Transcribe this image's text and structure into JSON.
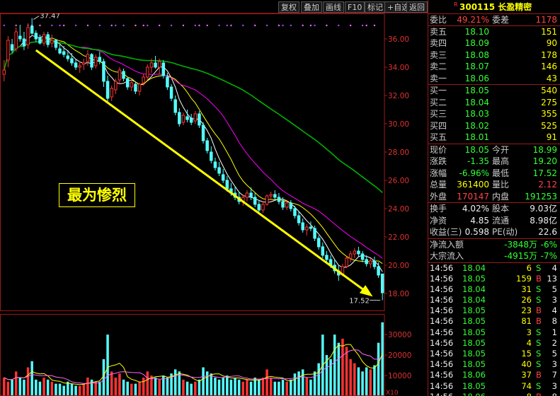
{
  "toolbar": {
    "buttons": [
      "复权",
      "叠加",
      "画线",
      "F10",
      "标记",
      "+自选",
      "返回"
    ]
  },
  "annotation": "最为惨烈",
  "chart_data": {
    "type": "candlestick",
    "candles": [
      [
        33.5,
        34.5,
        33.0,
        33.8
      ],
      [
        34.5,
        36.2,
        34.0,
        35.9
      ],
      [
        35.6,
        36.0,
        35.0,
        35.2
      ],
      [
        35.3,
        36.8,
        35.1,
        36.5
      ],
      [
        36.2,
        37.0,
        35.8,
        36.0
      ],
      [
        36.0,
        36.5,
        35.2,
        35.5
      ],
      [
        35.6,
        37.1,
        35.3,
        36.8
      ],
      [
        36.9,
        37.47,
        36.3,
        36.4
      ],
      [
        36.4,
        36.6,
        35.8,
        36.0
      ],
      [
        36.1,
        36.3,
        35.6,
        35.7
      ],
      [
        35.7,
        36.5,
        35.5,
        36.3
      ],
      [
        36.3,
        36.5,
        35.4,
        35.6
      ],
      [
        35.7,
        36.3,
        35.4,
        35.9
      ],
      [
        35.9,
        36.0,
        35.2,
        35.4
      ],
      [
        35.3,
        35.6,
        34.9,
        35.0
      ],
      [
        35.1,
        35.5,
        34.7,
        34.9
      ],
      [
        34.8,
        35.2,
        34.4,
        34.6
      ],
      [
        34.6,
        35.0,
        34.1,
        34.3
      ],
      [
        34.3,
        34.6,
        33.8,
        34.0
      ],
      [
        34.0,
        34.4,
        33.6,
        34.1
      ],
      [
        34.2,
        34.6,
        33.8,
        34.3
      ],
      [
        34.4,
        35.2,
        34.1,
        34.9
      ],
      [
        34.9,
        35.0,
        33.8,
        34.0
      ],
      [
        34.1,
        34.9,
        33.9,
        34.7
      ],
      [
        34.7,
        35.1,
        34.2,
        34.4
      ],
      [
        34.4,
        34.6,
        32.6,
        33.0
      ],
      [
        33.0,
        33.4,
        31.5,
        31.8
      ],
      [
        31.9,
        32.7,
        31.6,
        32.5
      ],
      [
        32.4,
        33.2,
        32.1,
        33.0
      ],
      [
        33.1,
        34.0,
        32.8,
        33.8
      ],
      [
        33.7,
        33.9,
        33.0,
        33.2
      ],
      [
        33.2,
        33.3,
        32.4,
        32.6
      ],
      [
        32.6,
        33.1,
        32.3,
        32.9
      ],
      [
        32.8,
        33.0,
        32.1,
        32.3
      ],
      [
        32.3,
        32.9,
        32.0,
        32.8
      ],
      [
        32.9,
        33.5,
        32.7,
        33.3
      ],
      [
        33.3,
        34.2,
        33.1,
        34.0
      ],
      [
        34.0,
        34.6,
        33.6,
        34.3
      ],
      [
        34.3,
        34.8,
        33.9,
        34.0
      ],
      [
        34.0,
        34.6,
        33.5,
        34.4
      ],
      [
        34.3,
        34.5,
        33.2,
        33.4
      ],
      [
        33.3,
        33.6,
        32.4,
        32.6
      ],
      [
        32.6,
        32.8,
        31.6,
        31.8
      ],
      [
        31.7,
        32.0,
        30.6,
        30.8
      ],
      [
        30.8,
        31.1,
        29.8,
        30.0
      ],
      [
        30.1,
        30.8,
        29.9,
        30.6
      ],
      [
        30.5,
        31.0,
        30.1,
        30.3
      ],
      [
        30.4,
        30.7,
        29.9,
        30.1
      ],
      [
        30.2,
        30.9,
        30.0,
        30.7
      ],
      [
        30.7,
        30.9,
        29.7,
        29.9
      ],
      [
        29.9,
        30.1,
        28.6,
        28.8
      ],
      [
        28.8,
        29.0,
        27.9,
        28.1
      ],
      [
        28.0,
        28.4,
        27.2,
        27.4
      ],
      [
        27.3,
        27.6,
        26.7,
        26.9
      ],
      [
        26.9,
        27.3,
        26.3,
        26.5
      ],
      [
        26.4,
        26.8,
        25.8,
        26.0
      ],
      [
        26.0,
        26.3,
        25.2,
        25.4
      ],
      [
        25.4,
        25.8,
        24.9,
        25.1
      ],
      [
        25.1,
        25.6,
        24.6,
        24.8
      ],
      [
        24.8,
        25.2,
        24.3,
        24.5
      ],
      [
        24.5,
        25.0,
        24.2,
        24.8
      ],
      [
        24.8,
        25.3,
        24.5,
        25.1
      ],
      [
        25.1,
        25.5,
        24.6,
        24.8
      ],
      [
        24.8,
        25.1,
        24.1,
        24.3
      ],
      [
        24.3,
        24.6,
        23.7,
        23.9
      ],
      [
        23.9,
        24.5,
        23.7,
        24.3
      ],
      [
        24.3,
        25.0,
        24.2,
        24.9
      ],
      [
        24.9,
        25.2,
        24.6,
        25.0
      ],
      [
        25.0,
        25.3,
        24.6,
        24.8
      ],
      [
        24.8,
        25.1,
        24.3,
        24.5
      ],
      [
        24.5,
        24.8,
        23.9,
        24.1
      ],
      [
        24.1,
        24.6,
        23.9,
        24.4
      ],
      [
        24.4,
        24.6,
        23.8,
        24.0
      ],
      [
        24.0,
        24.2,
        23.3,
        23.5
      ],
      [
        23.5,
        23.8,
        22.8,
        23.0
      ],
      [
        23.0,
        23.3,
        22.3,
        22.5
      ],
      [
        22.5,
        22.9,
        22.1,
        22.7
      ],
      [
        22.7,
        23.1,
        22.4,
        22.6
      ],
      [
        22.6,
        22.8,
        21.7,
        21.9
      ],
      [
        21.9,
        22.1,
        21.1,
        21.3
      ],
      [
        21.3,
        21.6,
        20.5,
        20.7
      ],
      [
        20.7,
        21.0,
        20.2,
        20.4
      ],
      [
        20.4,
        20.7,
        19.8,
        20.0
      ],
      [
        20.0,
        20.4,
        19.4,
        19.6
      ],
      [
        19.6,
        20.0,
        18.9,
        19.3
      ],
      [
        19.3,
        20.1,
        19.2,
        19.9
      ],
      [
        19.9,
        20.6,
        19.8,
        20.5
      ],
      [
        20.5,
        21.0,
        20.2,
        20.8
      ],
      [
        20.8,
        21.2,
        20.5,
        21.0
      ],
      [
        21.0,
        21.3,
        20.6,
        20.8
      ],
      [
        20.8,
        21.0,
        20.2,
        20.4
      ],
      [
        20.4,
        20.7,
        19.9,
        20.1
      ],
      [
        20.1,
        20.5,
        19.8,
        20.3
      ],
      [
        20.3,
        20.6,
        19.7,
        19.9
      ],
      [
        19.9,
        20.2,
        19.1,
        19.3
      ],
      [
        19.38,
        19.4,
        17.52,
        18.05
      ]
    ],
    "volumes": [
      9000,
      7000,
      8000,
      12000,
      9000,
      8000,
      14000,
      17000,
      8000,
      7000,
      9000,
      8000,
      7000,
      6000,
      6000,
      5000,
      7000,
      6000,
      5000,
      5000,
      6000,
      9000,
      8000,
      7000,
      7000,
      18000,
      30000,
      12000,
      9000,
      11000,
      8000,
      7000,
      6000,
      6000,
      7000,
      9000,
      12000,
      10000,
      9000,
      8000,
      10000,
      9000,
      11000,
      13000,
      12000,
      8000,
      7000,
      6000,
      7000,
      8000,
      14000,
      12000,
      11000,
      9000,
      8000,
      9000,
      10000,
      8000,
      9000,
      8000,
      7000,
      8000,
      7000,
      9000,
      8000,
      9000,
      13000,
      9000,
      7000,
      7000,
      8000,
      7000,
      8000,
      11000,
      12000,
      13000,
      9000,
      8000,
      12000,
      16000,
      30000,
      20000,
      18000,
      30000,
      26000,
      28000,
      24000,
      18000,
      16000,
      14000,
      12000,
      14000,
      13000,
      15000,
      26000,
      36000
    ],
    "ma_periods": [
      5,
      10,
      20,
      60
    ],
    "ma_colors": [
      "#ffffff",
      "#ffff00",
      "#ff00ff",
      "#00b000"
    ],
    "ylim": [
      16.8,
      37.8
    ],
    "yticks": [
      "36.00",
      "34.00",
      "32.00",
      "30.00",
      "28.00",
      "26.00",
      "24.00",
      "22.00",
      "20.00",
      "18.00"
    ],
    "vol_ylim": [
      0,
      38000
    ],
    "vol_ticks": [
      "30000",
      "20000",
      "10000"
    ],
    "vol_unit": "X10",
    "max_label": "37.47",
    "min_label": "17.52",
    "colors": {
      "up": "#ff3333",
      "down": "#54ffff",
      "trend_arrow": "#ffff00"
    }
  },
  "quote": {
    "code": "300115",
    "name": "长盈精密",
    "r_mark": "R",
    "webi_label": "委比",
    "webi": "49.21%",
    "weicha_label": "委差",
    "weicha": "1178",
    "asks": [
      {
        "label": "卖五",
        "price": "18.10",
        "vol": "151"
      },
      {
        "label": "卖四",
        "price": "18.09",
        "vol": "90"
      },
      {
        "label": "卖三",
        "price": "18.08",
        "vol": "178"
      },
      {
        "label": "卖二",
        "price": "18.07",
        "vol": "146"
      },
      {
        "label": "卖一",
        "price": "18.06",
        "vol": "43"
      }
    ],
    "bids": [
      {
        "label": "买一",
        "price": "18.05",
        "vol": "540"
      },
      {
        "label": "买二",
        "price": "18.04",
        "vol": "275"
      },
      {
        "label": "买三",
        "price": "18.03",
        "vol": "355"
      },
      {
        "label": "买四",
        "price": "18.02",
        "vol": "525"
      },
      {
        "label": "买五",
        "price": "18.01",
        "vol": "91"
      }
    ],
    "stats": [
      {
        "l1": "现价",
        "v1": "18.05",
        "c1": "g",
        "l2": "今开",
        "v2": "18.99",
        "c2": "g"
      },
      {
        "l1": "涨跌",
        "v1": "-1.35",
        "c1": "g",
        "l2": "最高",
        "v2": "19.20",
        "c2": "g"
      },
      {
        "l1": "涨幅",
        "v1": "-6.96%",
        "c1": "g",
        "l2": "最低",
        "v2": "17.52",
        "c2": "g"
      },
      {
        "l1": "总量",
        "v1": "361400",
        "c1": "y",
        "l2": "量比",
        "v2": "2.12",
        "c2": "r"
      },
      {
        "l1": "外盘",
        "v1": "170147",
        "c1": "r",
        "l2": "内盘",
        "v2": "191253",
        "c2": "g"
      }
    ],
    "fund": [
      {
        "l1": "换手",
        "v1": "4.02%",
        "l2": "股本",
        "v2": "9.03亿"
      },
      {
        "l1": "净资",
        "v1": "4.85",
        "l2": "流通",
        "v2": "8.98亿"
      },
      {
        "l1": "收益(三)",
        "v1": "0.598",
        "l2": "PE(动)",
        "v2": "22.6"
      }
    ],
    "flows": [
      {
        "label": "净流入额",
        "value": "-3848万",
        "pct": "-6%"
      },
      {
        "label": "大宗流入",
        "value": "-4915万",
        "pct": "-7%"
      }
    ],
    "ticks": [
      {
        "t": "14:56",
        "p": "18.04",
        "pc": "g",
        "v": "6",
        "s": "S",
        "n": "4"
      },
      {
        "t": "14:56",
        "p": "18.05",
        "pc": "g",
        "v": "159",
        "s": "B",
        "n": "13"
      },
      {
        "t": "14:56",
        "p": "18.04",
        "pc": "g",
        "v": "31",
        "s": "S",
        "n": "5"
      },
      {
        "t": "14:56",
        "p": "18.04",
        "pc": "g",
        "v": "26",
        "s": "S",
        "n": "3"
      },
      {
        "t": "14:56",
        "p": "18.05",
        "pc": "g",
        "v": "23",
        "s": "B",
        "n": "4"
      },
      {
        "t": "14:56",
        "p": "18.05",
        "pc": "g",
        "v": "81",
        "s": "B",
        "n": "8"
      },
      {
        "t": "14:56",
        "p": "18.05",
        "pc": "g",
        "v": "3",
        "s": "S",
        "n": "1"
      },
      {
        "t": "14:56",
        "p": "18.05",
        "pc": "g",
        "v": "4",
        "s": "S",
        "n": "2"
      },
      {
        "t": "14:56",
        "p": "18.05",
        "pc": "g",
        "v": "15",
        "s": "S",
        "n": "5"
      },
      {
        "t": "14:56",
        "p": "18.05",
        "pc": "g",
        "v": "40",
        "s": "S",
        "n": "3"
      },
      {
        "t": "14:56",
        "p": "18.06",
        "pc": "g",
        "v": "37",
        "s": "B",
        "n": "7"
      },
      {
        "t": "14:56",
        "p": "18.05",
        "pc": "g",
        "v": "74",
        "s": "S",
        "n": "3"
      },
      {
        "t": "14:56",
        "p": "18.06",
        "pc": "g",
        "v": "8",
        "s": "B",
        "n": "8"
      }
    ]
  }
}
